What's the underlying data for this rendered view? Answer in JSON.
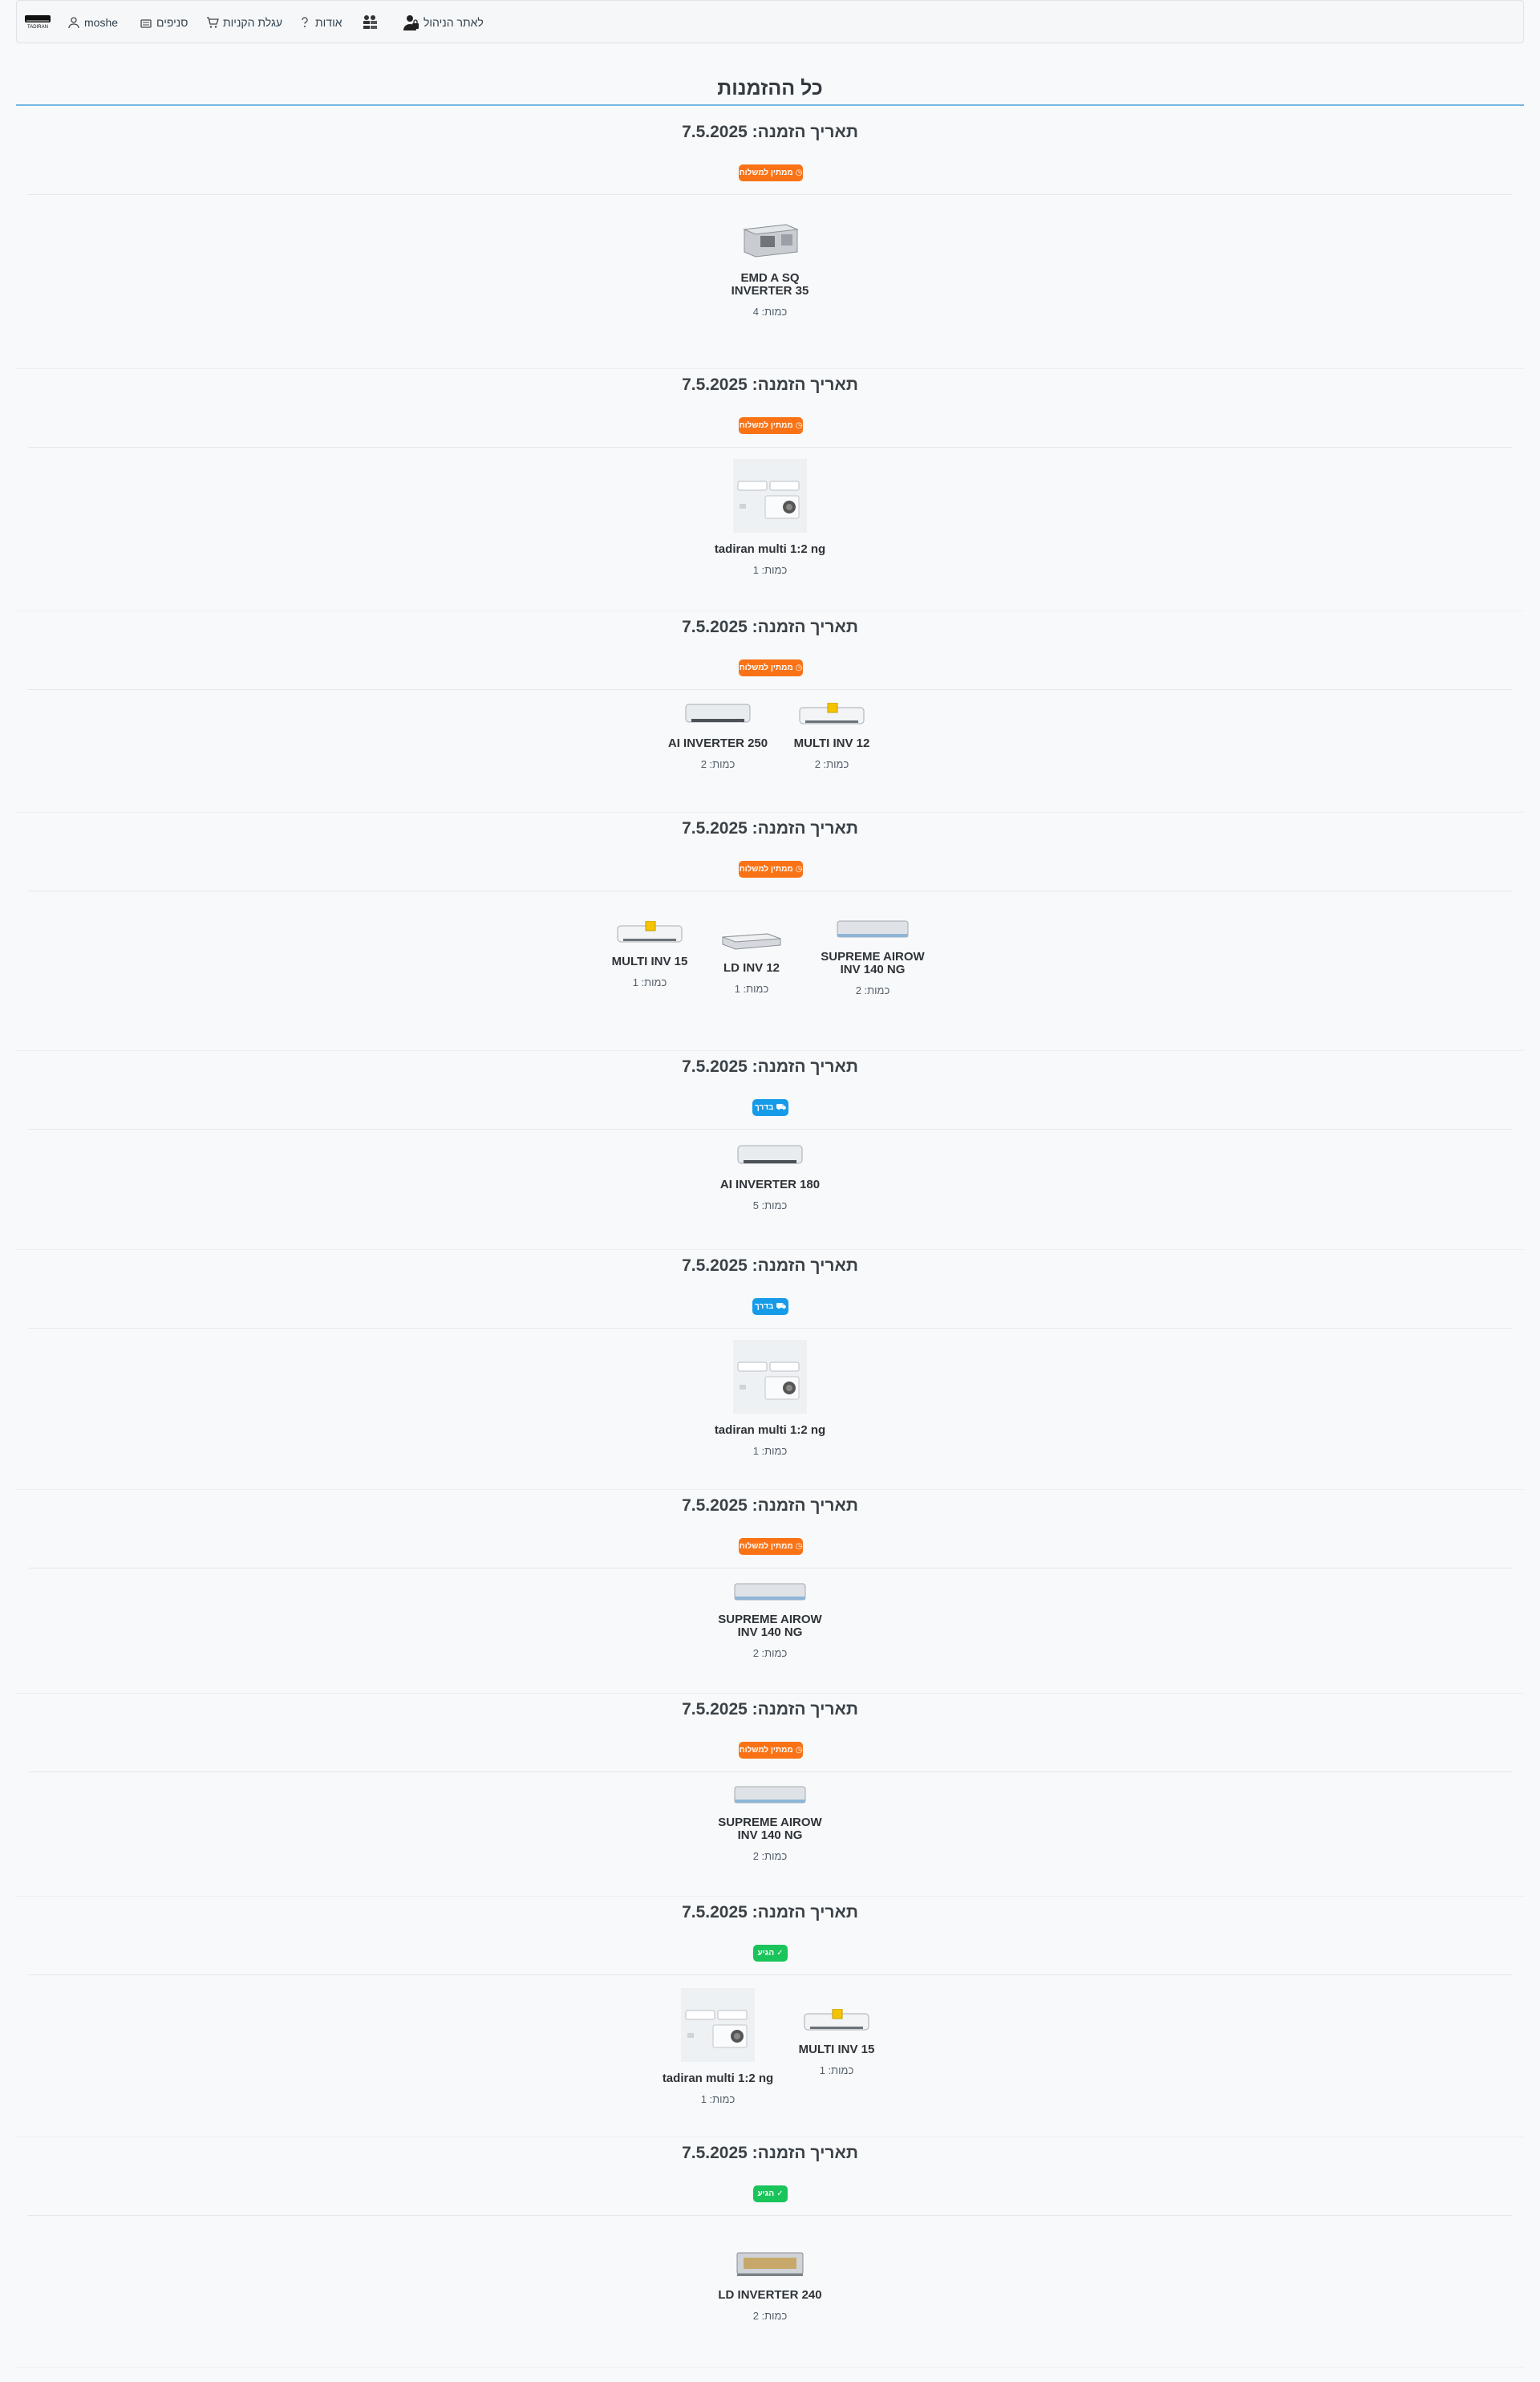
{
  "nav": {
    "brand_text": "TADIRAN",
    "user": "moshe",
    "categories": "סניפים",
    "cart": "עגלת הקניות",
    "about": "אודות",
    "admin": "לאתר הניהול"
  },
  "page": {
    "title": "כל ההזמנות"
  },
  "orders": [
    {
      "date": "תאריך הזמנה: 7.5.2025",
      "status": "ממתין למשלוח",
      "status_type": "pending",
      "items": [
        {
          "name": "EMD A SQ\nINVERTER 35",
          "qty": "כמות: 4",
          "image": "duct"
        }
      ]
    },
    {
      "date": "תאריך הזמנה: 7.5.2025",
      "status": "ממתין למשלוח",
      "status_type": "pending",
      "items": [
        {
          "name": "tadiran multi 1:2 ng",
          "qty": "כמות: 1",
          "image": "multi"
        }
      ]
    },
    {
      "date": "תאריך הזמנה: 7.5.2025",
      "status": "ממתין למשלוח",
      "status_type": "pending",
      "items": [
        {
          "name": "MULTI INV 12",
          "qty": "כמות: 2",
          "image": "split-tag"
        },
        {
          "name": "AI INVERTER 250",
          "qty": "כמות: 2",
          "image": "split"
        }
      ]
    },
    {
      "date": "תאריך הזמנה: 7.5.2025",
      "status": "ממתין למשלוח",
      "status_type": "pending",
      "items": [
        {
          "name": "SUPREME AIROW\nINV 140 NG",
          "qty": "כמות: 2",
          "image": "supreme"
        },
        {
          "name": "LD INV 12",
          "qty": "כמות: 1",
          "image": "ld"
        },
        {
          "name": "MULTI INV 15",
          "qty": "כמות: 1",
          "image": "split-tag"
        }
      ]
    },
    {
      "date": "תאריך הזמנה: 7.5.2025",
      "status": "בדרך",
      "status_type": "shipping",
      "items": [
        {
          "name": "AI INVERTER 180",
          "qty": "כמות: 5",
          "image": "split"
        }
      ]
    },
    {
      "date": "תאריך הזמנה: 7.5.2025",
      "status": "בדרך",
      "status_type": "shipping",
      "items": [
        {
          "name": "tadiran multi 1:2 ng",
          "qty": "כמות: 1",
          "image": "multi"
        }
      ]
    },
    {
      "date": "תאריך הזמנה: 7.5.2025",
      "status": "ממתין למשלוח",
      "status_type": "pending",
      "items": [
        {
          "name": "SUPREME AIROW\nINV 140 NG",
          "qty": "כמות: 2",
          "image": "supreme"
        }
      ]
    },
    {
      "date": "תאריך הזמנה: 7.5.2025",
      "status": "ממתין למשלוח",
      "status_type": "pending",
      "items": [
        {
          "name": "SUPREME AIROW\nINV 140 NG",
          "qty": "כמות: 2",
          "image": "supreme"
        }
      ]
    },
    {
      "date": "תאריך הזמנה: 7.5.2025",
      "status": "הגיע",
      "status_type": "done",
      "items": [
        {
          "name": "MULTI INV 15",
          "qty": "כמות: 1",
          "image": "split-tag"
        },
        {
          "name": "tadiran multi 1:2 ng",
          "qty": "כמות: 1",
          "image": "multi"
        }
      ]
    },
    {
      "date": "תאריך הזמנה: 7.5.2025",
      "status": "הגיע",
      "status_type": "done",
      "items": [
        {
          "name": "LD INVERTER 240",
          "qty": "כמות: 2",
          "image": "ld240"
        }
      ]
    }
  ]
}
